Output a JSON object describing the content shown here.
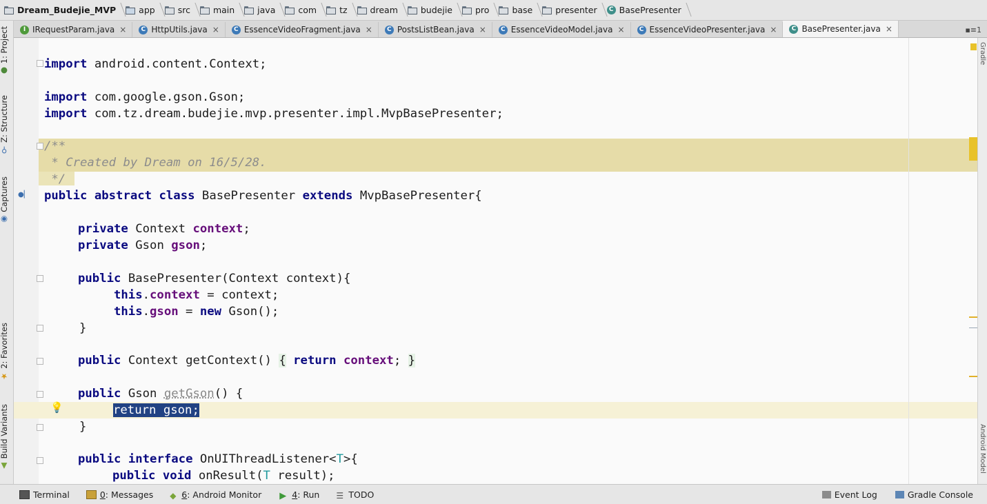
{
  "breadcrumbs": [
    {
      "label": "Dream_Budejie_MVP",
      "icon": "project-icon"
    },
    {
      "label": "app",
      "icon": "module-folder-icon"
    },
    {
      "label": "src",
      "icon": "folder-icon"
    },
    {
      "label": "main",
      "icon": "folder-icon"
    },
    {
      "label": "java",
      "icon": "source-folder-icon"
    },
    {
      "label": "com",
      "icon": "package-icon"
    },
    {
      "label": "tz",
      "icon": "package-icon"
    },
    {
      "label": "dream",
      "icon": "package-icon"
    },
    {
      "label": "budejie",
      "icon": "package-icon"
    },
    {
      "label": "pro",
      "icon": "package-icon"
    },
    {
      "label": "base",
      "icon": "package-icon"
    },
    {
      "label": "presenter",
      "icon": "package-icon"
    },
    {
      "label": "BasePresenter",
      "icon": "abstract-class-icon"
    }
  ],
  "tabs": [
    {
      "label": "IRequestParam.java",
      "icon": "interface-icon",
      "icon_letter": "I",
      "icon_color": "#4e9a3a",
      "active": false
    },
    {
      "label": "HttpUtils.java",
      "icon": "class-icon",
      "icon_letter": "C",
      "icon_color": "#3d7ab8",
      "active": false
    },
    {
      "label": "EssenceVideoFragment.java",
      "icon": "class-icon",
      "icon_letter": "C",
      "icon_color": "#3d7ab8",
      "active": false
    },
    {
      "label": "PostsListBean.java",
      "icon": "class-icon",
      "icon_letter": "C",
      "icon_color": "#3d7ab8",
      "active": false
    },
    {
      "label": "EssenceVideoModel.java",
      "icon": "class-icon",
      "icon_letter": "C",
      "icon_color": "#3d7ab8",
      "active": false
    },
    {
      "label": "EssenceVideoPresenter.java",
      "icon": "class-icon",
      "icon_letter": "C",
      "icon_color": "#3d7ab8",
      "active": false
    },
    {
      "label": "BasePresenter.java",
      "icon": "abstract-class-icon",
      "icon_letter": "C",
      "icon_color": "#3f8f8a",
      "active": true
    }
  ],
  "tab_close_glyph": "×",
  "tabs_overflow": "▪≡1",
  "left_tools": [
    {
      "label": "1: Project",
      "icon": "project-tool-icon"
    },
    {
      "label": "Z: Structure",
      "icon": "structure-tool-icon"
    },
    {
      "label": "Captures",
      "icon": "captures-tool-icon"
    },
    {
      "label": "2: Favorites",
      "icon": "star-icon"
    },
    {
      "label": "Build Variants",
      "icon": "android-icon"
    }
  ],
  "right_tools": [
    {
      "label": "Gradle",
      "icon": "gradle-icon"
    },
    {
      "label": "Android Model",
      "icon": "android-model-icon"
    }
  ],
  "code": {
    "l1": {
      "kw": "import",
      "rest": " android.content.Context;"
    },
    "l2": {
      "kw": "import",
      "rest": " com.google.gson.Gson;"
    },
    "l3": {
      "kw": "import",
      "rest": " com.tz.dream.budejie.mvp.presenter.impl.MvpBasePresenter;"
    },
    "l4": "/**",
    "l5": " * Created by Dream on 16/5/28.",
    "l6": " */",
    "l7": {
      "kw1": "public",
      "kw2": "abstract",
      "kw3": "class",
      "name": " BasePresenter ",
      "kw4": "extends",
      "rest": " MvpBasePresenter{"
    },
    "l8": {
      "kw": "private",
      "type": " Context ",
      "field": "context",
      "end": ";"
    },
    "l9": {
      "kw": "private",
      "type": " Gson ",
      "field": "gson",
      "end": ";"
    },
    "l10": {
      "kw": "public",
      "rest": " BasePresenter(Context context){"
    },
    "l11": {
      "kw": "this",
      "dot": ".",
      "field": "context",
      "rest": " = context;"
    },
    "l12": {
      "kw": "this",
      "dot": ".",
      "field": "gson",
      "mid": " = ",
      "kw2": "new",
      "rest": " Gson();"
    },
    "l13": "}",
    "l14": {
      "kw": "public",
      "type": " Context getContext() ",
      "ob": "{",
      "sp": " ",
      "kw2": "return",
      "sp2": " ",
      "field": "context",
      "end": "; ",
      "cb": "}"
    },
    "l15": {
      "kw": "public",
      "type": " Gson ",
      "dim": "getGson",
      "rest": "() {"
    },
    "l16": "return gson;",
    "l17": "}",
    "l18": {
      "kw": "public",
      "sp": " ",
      "kw2": "interface",
      "rest": " OnUIThreadListener<",
      "tparam": "T",
      "end": ">{"
    },
    "l19": {
      "kw": "public",
      "sp": " ",
      "kw2": "void",
      "rest": " onResult(",
      "tparam": "T",
      "end": " result);"
    }
  },
  "bottom_tools": [
    {
      "label": "Terminal",
      "mnemonic": "",
      "icon": "terminal-icon"
    },
    {
      "label": ": Messages",
      "mnemonic": "0",
      "icon": "messages-icon"
    },
    {
      "label": ": Android Monitor",
      "mnemonic": "6",
      "icon": "android-monitor-icon"
    },
    {
      "label": ": Run",
      "mnemonic": "4",
      "icon": "run-icon"
    },
    {
      "label": "TODO",
      "mnemonic": "",
      "icon": "todo-icon"
    }
  ],
  "bottom_right": [
    {
      "label": "Event Log",
      "icon": "event-log-icon"
    },
    {
      "label": "Gradle Console",
      "icon": "gradle-console-icon"
    }
  ],
  "colors": {
    "keyword": "#0a0a80",
    "field": "#660e7a",
    "comment": "#8c8c8c",
    "selection": "#214283",
    "doc_band": "#e6dca8"
  }
}
